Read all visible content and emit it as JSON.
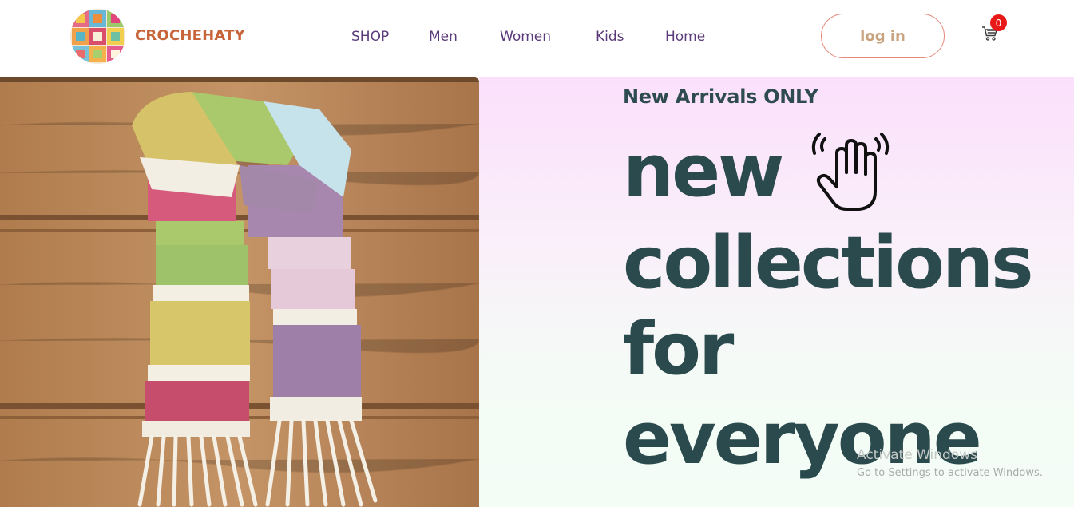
{
  "header": {
    "brand": "CROCHEHATY",
    "nav": [
      {
        "label": "SHOP",
        "id": "shop"
      },
      {
        "label": "Men",
        "id": "men"
      },
      {
        "label": "Women",
        "id": "women"
      },
      {
        "label": "Kids",
        "id": "kids"
      },
      {
        "label": "Home",
        "id": "home"
      }
    ],
    "login_label": "log in",
    "cart_count": "0"
  },
  "hero": {
    "tagline": "New Arrivals ONLY",
    "headline": [
      "new",
      "collections",
      "for",
      "everyone"
    ],
    "image_subject": "crochet-scarf-photo"
  },
  "watermark": {
    "title": "Activate Windows",
    "subtitle": "Go to Settings to activate Windows."
  },
  "colors": {
    "brand": "#c8643a",
    "nav": "#5b3a7a",
    "headline": "#2b4a4d",
    "login_border": "#e5877a",
    "badge": "#e81919"
  }
}
